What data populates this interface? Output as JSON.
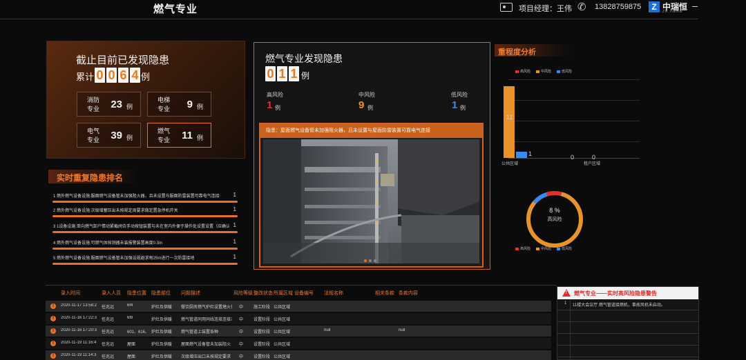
{
  "header": {
    "title": "燃气专业",
    "manager_label": "项目经理：王伟",
    "phone": "13828759875",
    "logo_mark": "Z",
    "logo_text": "中瑞恒",
    "logo_sub": "ZR HENG"
  },
  "summary": {
    "title": "截止目前已发现隐患",
    "lead": "累计",
    "digits": [
      "0",
      "0",
      "6",
      "4"
    ],
    "unit": "例",
    "categories": [
      {
        "name": "消防专业",
        "count": "23",
        "unit": "例",
        "active": false
      },
      {
        "name": "电梯专业",
        "count": "9",
        "unit": "例",
        "active": false
      },
      {
        "name": "电气专业",
        "count": "39",
        "unit": "例",
        "active": false
      },
      {
        "name": "燃气专业",
        "count": "11",
        "unit": "例",
        "active": true
      }
    ]
  },
  "ranking": {
    "title": "实时重复隐患排名",
    "items": [
      {
        "text": "1  燃外燃气设备设施:服面燃气设备管未加强阻火器，且未设置与服面防雷装置可靠电气连接",
        "count": "1"
      },
      {
        "text": "2  燃外燃气设备设施:次级增塞压出未按规定周要求做定置急停机开关",
        "count": "1"
      },
      {
        "text": "3  1设备设施:单向燃气卸户情动紧截阀合手动按钮装置与未在室内外便于操作处设置设置（应确认位",
        "count": "1"
      },
      {
        "text": "4  燃外燃气设备设施:可燃气体探测器未装报警装置高度0.3m",
        "count": "1"
      },
      {
        "text": "5  燃外燃气设备设施:服面燃气设备管未加强设规避求每25m进行一次防雷接地",
        "count": "1"
      }
    ]
  },
  "center": {
    "title": "燃气专业发现隐患",
    "digits": [
      "0",
      "1",
      "1"
    ],
    "unit": "例",
    "risks": [
      {
        "label": "高风险",
        "count": "1",
        "unit": "例",
        "color": "#e0322c"
      },
      {
        "label": "中风险",
        "count": "9",
        "unit": "例",
        "color": "#e8922a"
      },
      {
        "label": "低风险",
        "count": "1",
        "unit": "例",
        "color": "#3a8bf0"
      }
    ],
    "caption": "隐患：屋面燃气设备管未加强阻火器，且未设置与屋面防雷装置可靠电气连接"
  },
  "analysis": {
    "title": "重程度分析",
    "legend": [
      {
        "label": "高风险",
        "color": "#e0322c"
      },
      {
        "label": "中风险",
        "color": "#e8922a"
      },
      {
        "label": "低风险",
        "color": "#3a8bf0"
      }
    ],
    "chart_data": {
      "type": "bar",
      "categories": [
        "公共区域",
        "租户区域"
      ],
      "series": [
        {
          "name": "高风险",
          "values": [
            0,
            0
          ]
        },
        {
          "name": "中风险",
          "values": [
            11,
            0
          ]
        },
        {
          "name": "低风险",
          "values": [
            1,
            0
          ]
        }
      ],
      "value_labels": [
        "11",
        "1",
        "0",
        "0"
      ],
      "ylim": [
        0,
        12
      ]
    },
    "donut": {
      "percent_label": "8 %",
      "label": "高风险",
      "slices": [
        {
          "name": "高风险",
          "value": 1
        },
        {
          "name": "中风险",
          "value": 9
        },
        {
          "name": "低风险",
          "value": 1
        }
      ]
    }
  },
  "table": {
    "headers": [
      "录入时间",
      "录入人员",
      "隐患位置",
      "隐患部位",
      "问题描述",
      "风险等级",
      "整改状态",
      "所属区域",
      "设备编号",
      "法规名称",
      "相关条款",
      "条款内容"
    ],
    "rows": [
      {
        "time": "2020-11-17 13:58:2",
        "person": "任兆远",
        "loc": "6f4",
        "part": "炉灶及供暖",
        "desc": "餐饮厨房燃气炉灶设置熄火保护",
        "level": "中",
        "status": "施工阶段",
        "area": "公共区域",
        "dev": "",
        "law": "",
        "clause": ""
      },
      {
        "time": "2020-11-16 17:22:3",
        "person": "任兆远",
        "loc": "6f8",
        "part": "炉灶及供暖",
        "desc": "燃气管道同用同线连接连接冰",
        "level": "中",
        "status": "设置阶段",
        "area": "公共区域",
        "dev": "",
        "law": "",
        "clause": ""
      },
      {
        "time": "2020-11-16 17:20:3",
        "person": "任兆远",
        "loc": "601、616、68",
        "part": "炉灶及供暖",
        "desc": "燃气管道上装置各种",
        "level": "中",
        "status": "设置阶段",
        "area": "公共区域",
        "dev": "",
        "law": "null",
        "clause": "null"
      },
      {
        "time": "2020-11-19 11:16:4",
        "person": "任兆远",
        "loc": "屋面",
        "part": "炉灶及供暖",
        "desc": "屋面燃气设备管未加装阻火",
        "level": "中",
        "status": "设置阶段",
        "area": "公共区域",
        "dev": "",
        "law": "",
        "clause": ""
      },
      {
        "time": "2020-11-19 11:14:3",
        "person": "任兆远",
        "loc": "屋面",
        "part": "炉灶及供暖",
        "desc": "次级增压出口未按规定要求",
        "level": "中",
        "status": "设置阶段",
        "area": "公共区域",
        "dev": "",
        "law": "",
        "clause": ""
      }
    ]
  },
  "alert": {
    "title": "燃气专业——实时高风险隐患警告",
    "rows": [
      {
        "n": "1",
        "text": "11楼大会议厅    燃气管道接燃机，事故风机未启动。"
      }
    ]
  }
}
